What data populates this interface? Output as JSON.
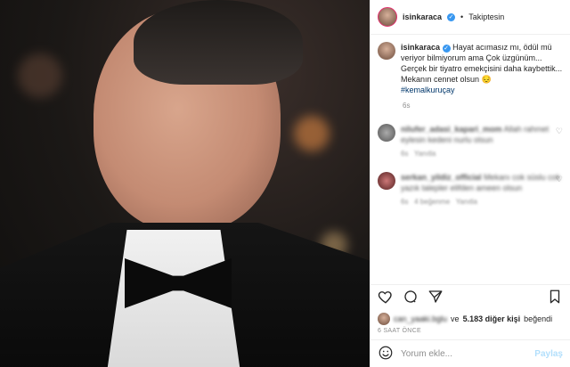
{
  "header": {
    "username": "isinkaraca",
    "separator": "•",
    "follow_label": "Takiptesin"
  },
  "caption": {
    "username": "isinkaraca",
    "text": "Hayat acımasız mı, ödül mü veriyor bilmiyorum ama Çok üzgünüm... Gerçek bir tiyatro emekçisini daha kaybettik... Mekanın cennet olsun 😔",
    "hashtag": "#kemalkuruçay",
    "time": "6s"
  },
  "comments": [
    {
      "username": "nilufer_adasi_kapari_mom",
      "text": "Allah rahmet eylesin kedeni nurlu olsun",
      "time": "6s",
      "reply": "Yanıtla"
    },
    {
      "username": "serkan_yildiz_official",
      "text": "Mekanı cok süslu cok yazık talepler elifden ameen olsun",
      "time": "6s",
      "likes": "4 beğenme",
      "reply": "Yanıtla"
    }
  ],
  "likes": {
    "user": "can_yaaki.bglu",
    "connector": "ve",
    "count": "5.183 diğer kişi",
    "suffix": "beğendi"
  },
  "timestamp": "6 SAAT ÖNCE",
  "add_comment": {
    "placeholder": "Yorum ekle...",
    "post_label": "Paylaş"
  },
  "icons": {
    "header_verified": "verified-badge-icon",
    "comment_heart": "heart-outline-icon",
    "like": "heart-icon",
    "comment": "comment-icon",
    "share": "send-icon",
    "save": "bookmark-icon",
    "emoji": "smiley-icon"
  },
  "colors": {
    "verified": "#3897f0",
    "link": "#00376b",
    "muted": "#8e8e8e",
    "post_button": "#b2dffc"
  }
}
